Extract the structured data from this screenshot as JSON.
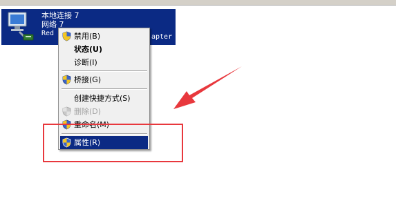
{
  "adapter": {
    "name": "本地连接 7",
    "network": "网络  7",
    "device_prefix": "Red",
    "device_suffix": "apter"
  },
  "context_menu": {
    "items": [
      {
        "label": "禁用(B)",
        "icon": "uac-shield-icon"
      },
      {
        "label": "状态(U)",
        "bold": true
      },
      {
        "label": "诊断(I)"
      },
      {
        "label": "桥接(G)",
        "icon": "uac-shield-icon"
      },
      {
        "label": "创建快捷方式(S)"
      },
      {
        "label": "删除(D)",
        "icon": "uac-shield-icon",
        "disabled": true
      },
      {
        "label": "重命名(M)",
        "icon": "uac-shield-icon"
      },
      {
        "label": "属性(R)",
        "icon": "uac-shield-icon",
        "highlighted": true
      }
    ]
  },
  "colors": {
    "selection": "#0b2a84",
    "annotation": "#e8383d",
    "menu_bg": "#f0f0f0"
  }
}
